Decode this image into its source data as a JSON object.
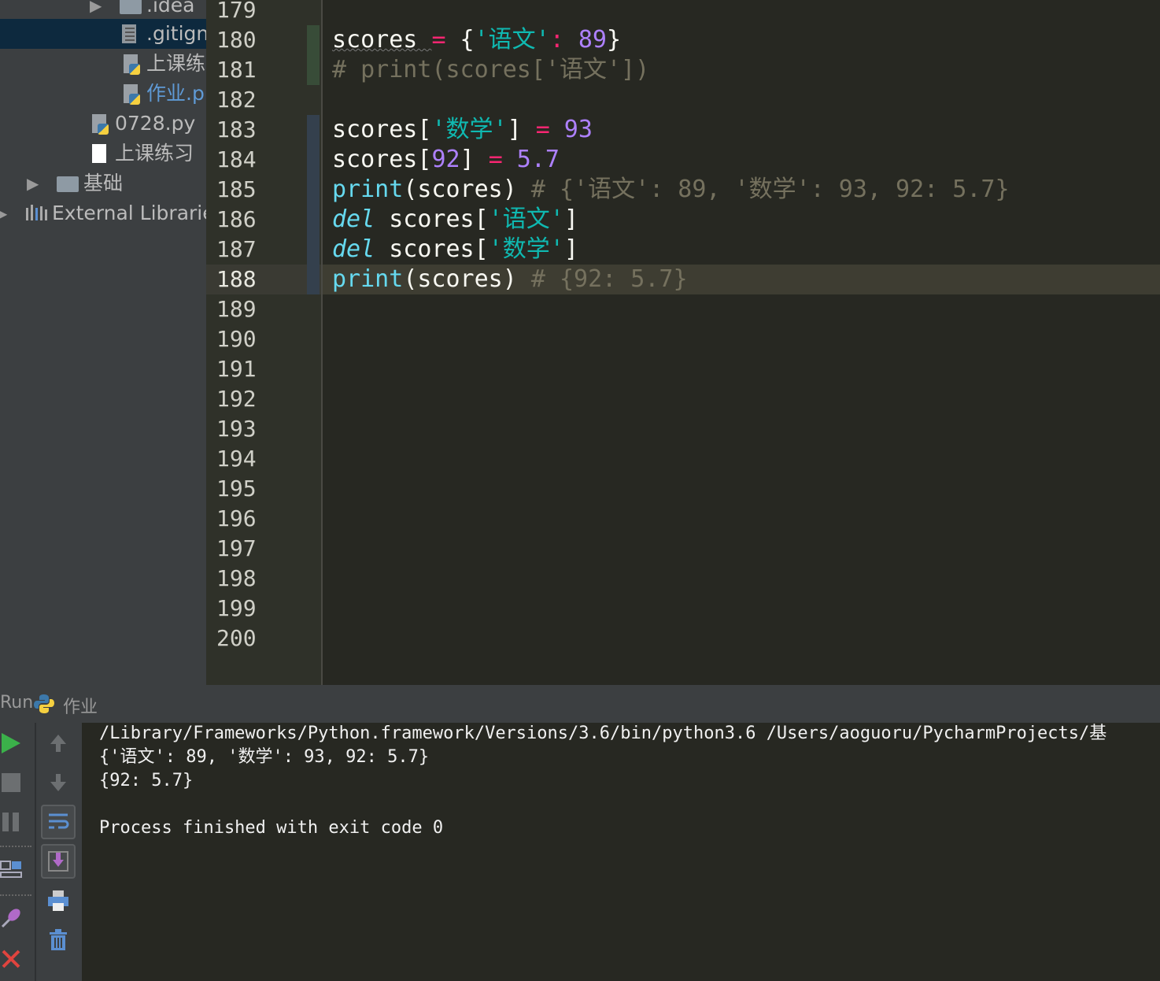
{
  "project_tree": {
    "items": [
      {
        "label": ".idea",
        "icon": "folder-icon"
      },
      {
        "label": ".gitign",
        "icon": "text-file-icon"
      },
      {
        "label": "上课练",
        "icon": "python-file-icon"
      },
      {
        "label": "作业.p",
        "icon": "python-file-icon"
      },
      {
        "label": "0728.py",
        "icon": "python-file-icon"
      },
      {
        "label": "上课练习",
        "icon": "file-icon"
      },
      {
        "label": "基础",
        "icon": "folder-icon"
      },
      {
        "label": "External Librarie",
        "icon": "library-icon"
      }
    ]
  },
  "editor": {
    "line_numbers": [
      "179",
      "180",
      "181",
      "182",
      "183",
      "184",
      "185",
      "186",
      "187",
      "188",
      "189",
      "190",
      "191",
      "192",
      "193",
      "194",
      "195",
      "196",
      "197",
      "198",
      "199",
      "200"
    ],
    "current_line": "188",
    "code": {
      "l180": {
        "var": "scores ",
        "eq": "=",
        "open": " {",
        "key": "'语文'",
        "colon": ":",
        "val": " 89",
        "close": "}"
      },
      "l181": {
        "comment": "# print(scores['语文'])"
      },
      "l183": {
        "var": "scores[",
        "key": "'数学'",
        "close": "] ",
        "eq": "=",
        "val": " 93"
      },
      "l184": {
        "var": "scores[",
        "key": "92",
        "close": "] ",
        "eq": "=",
        "val": " 5.7"
      },
      "l185": {
        "fn": "print",
        "args": "(scores) ",
        "comment": "# {'语文': 89, '数学': 93, 92: 5.7}"
      },
      "l186": {
        "kw": "del",
        "var": " scores[",
        "key": "'语文'",
        "close": "]"
      },
      "l187": {
        "kw": "del",
        "var": " scores[",
        "key": "'数学'",
        "close": "]"
      },
      "l188": {
        "fn": "print",
        "args": "(scores) ",
        "comment": "# {92: 5.7}"
      }
    }
  },
  "run_panel": {
    "label": "Run",
    "config_name": "作业",
    "output": [
      "/Library/Frameworks/Python.framework/Versions/3.6/bin/python3.6 /Users/aoguoru/PycharmProjects/基",
      "{'语文': 89, '数学': 93, 92: 5.7}",
      "{92: 5.7}",
      "",
      "Process finished with exit code 0"
    ]
  },
  "colors": {
    "accent_run": "#3bb14a",
    "close": "#e0443e",
    "sidebar": "#3c3f41",
    "editor_bg": "#272822"
  }
}
